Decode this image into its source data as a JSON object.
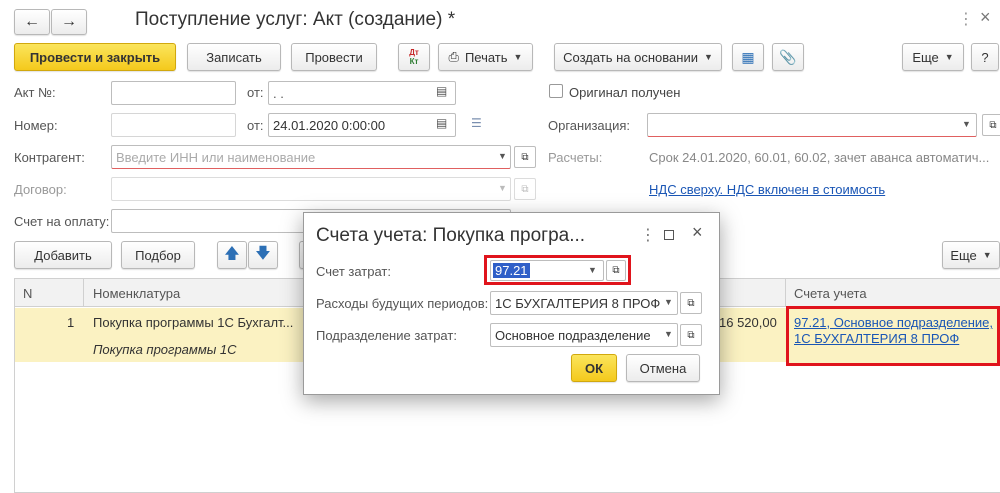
{
  "window": {
    "title": "Поступление услуг: Акт (создание) *"
  },
  "toolbar": {
    "post_close": "Провести и закрыть",
    "save": "Записать",
    "post": "Провести",
    "print": "Печать",
    "create_based": "Создать на основании",
    "more": "Еще",
    "help": "?"
  },
  "form": {
    "act_label": "Акт №:",
    "act_date_label": "от:",
    "act_date_value": ". .",
    "number_label": "Номер:",
    "number_date_label": "от:",
    "number_date_value": "24.01.2020  0:00:00",
    "original_label": "Оригинал получен",
    "organization_label": "Организация:",
    "contractor_label": "Контрагент:",
    "contractor_placeholder": "Введите ИНН или наименование",
    "settlements_label": "Расчеты:",
    "settlements_value": "Срок 24.01.2020, 60.01, 60.02, зачет аванса автоматич...",
    "contract_label": "Договор:",
    "vat_link": "НДС сверху. НДС включен в стоимость",
    "invoice_label": "Счет на оплату:"
  },
  "table_toolbar": {
    "add": "Добавить",
    "select": "Подбор",
    "more": "Еще"
  },
  "table": {
    "col_n": "N",
    "col_item": "Номенклатура",
    "col_accounts": "Счета учета",
    "row": {
      "n": "1",
      "item": "Покупка программы 1С Бухгалт...",
      "item_sub": "Покупка программы 1С",
      "sum": "16 520,00",
      "accounts_line1": "97.21, Основное подразделение,",
      "accounts_line2": "1С БУХГАЛТЕРИЯ 8 ПРОФ"
    }
  },
  "dialog": {
    "title": "Счета учета: Покупка програ...",
    "cost_account_label": "Счет затрат:",
    "cost_account_value": "97.21",
    "deferred_label": "Расходы будущих периодов:",
    "deferred_value": "1С БУХГАЛТЕРИЯ 8 ПРОФ",
    "division_label": "Подразделение затрат:",
    "division_value": "Основное подразделение",
    "ok": "ОК",
    "cancel": "Отмена"
  },
  "colors": {
    "accent_yellow": "#f4c91c",
    "highlight_red": "#e0141c",
    "row_yellow": "#fbf2c2",
    "link_blue": "#1a56b5"
  }
}
